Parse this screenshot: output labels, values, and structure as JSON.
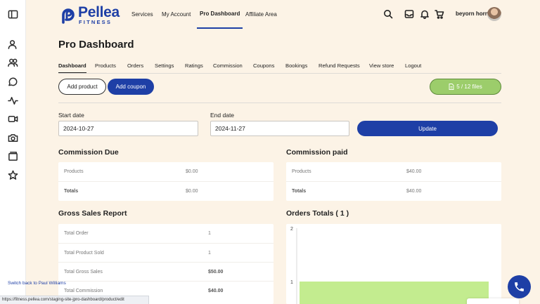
{
  "brand": {
    "name": "Pellea",
    "sub": "FITNESS",
    "color": "#1e3fa6"
  },
  "nav": [
    "Services",
    "My Account",
    "Pro Dashboard",
    "Affiliate Area"
  ],
  "user": {
    "name": "beyorn horn"
  },
  "page_title": "Pro Dashboard",
  "tabs": [
    "Dashboard",
    "Products",
    "Orders",
    "Settings",
    "Ratings",
    "Commission",
    "Coupons",
    "Bookings",
    "Refund Requests",
    "View store",
    "Logout"
  ],
  "actions": {
    "add_product": "Add product",
    "add_coupon": "Add coupon",
    "files": "5 / 12 files"
  },
  "filters": {
    "start_label": "Start date",
    "start_value": "2024-10-27",
    "end_label": "End date",
    "end_value": "2024-11-27",
    "update": "Update"
  },
  "commission_due": {
    "title": "Commission Due",
    "rows": [
      {
        "label": "Products",
        "value": "$0.00"
      },
      {
        "label": "Totals",
        "value": "$0.00"
      }
    ]
  },
  "commission_paid": {
    "title": "Commission paid",
    "rows": [
      {
        "label": "Products",
        "value": "$40.00"
      },
      {
        "label": "Totals",
        "value": "$40.00"
      }
    ]
  },
  "gross_sales": {
    "title": "Gross Sales Report",
    "rows": [
      {
        "label": "Total Order",
        "value": "1"
      },
      {
        "label": "Total Product Sold",
        "value": "1"
      },
      {
        "label": "Total Gross Sales",
        "value": "$50.00"
      },
      {
        "label": "Total Commission",
        "value": "$40.00"
      }
    ]
  },
  "orders_totals": {
    "title": "Orders Totals ( 1 )"
  },
  "chart_data": {
    "type": "bar",
    "title": "",
    "categories": [
      ""
    ],
    "values": [
      1
    ],
    "ylim": [
      0,
      2
    ],
    "yticks": [
      "2",
      "1"
    ],
    "bar_color": "#c3ec8f"
  },
  "footer": {
    "switch_back": "Switch back to Paul Williams",
    "url": "https://fitness.pellea.com/staging-site-jpro-dashboard/product/edit"
  }
}
